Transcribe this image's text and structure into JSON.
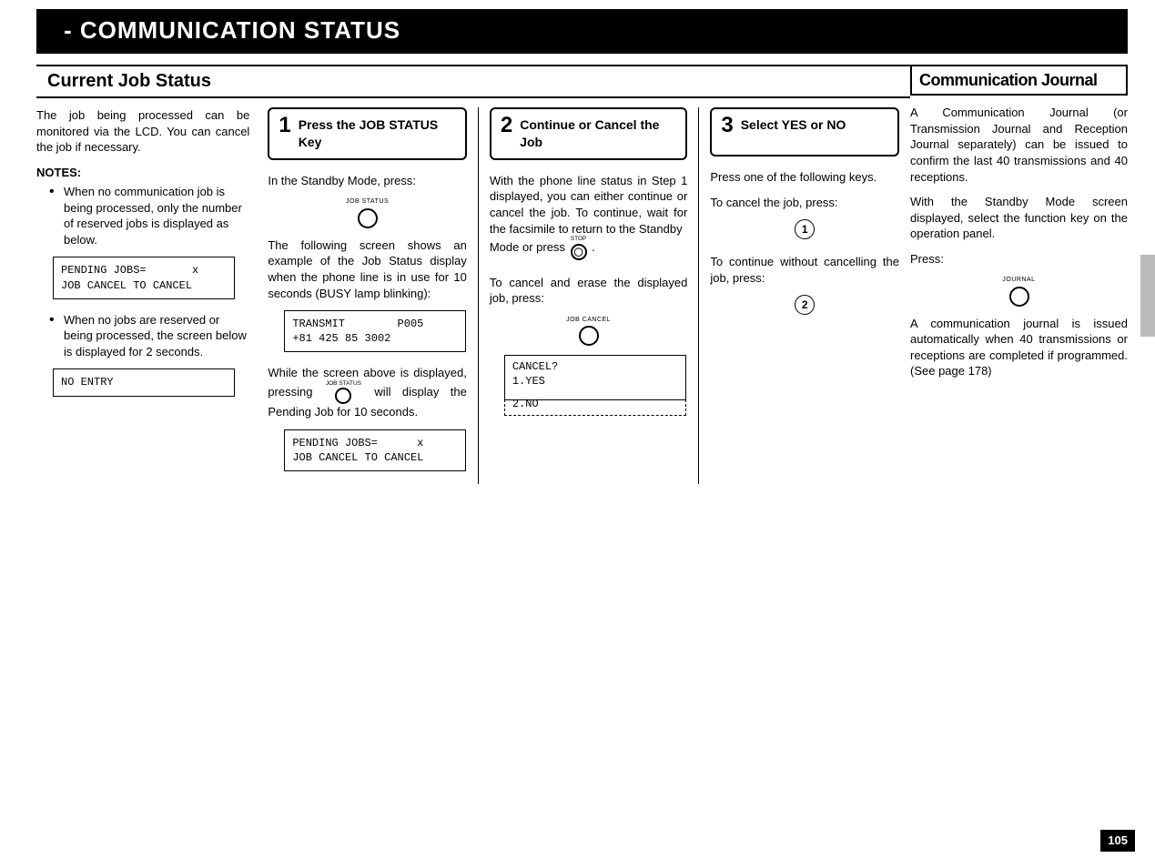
{
  "header": "- COMMUNICATION STATUS",
  "sectionLeft": "Current  Job  Status",
  "sectionRight": "Communication Journal",
  "pageNumber": "105",
  "intro": {
    "para1": "The job being processed can be monitored via the LCD. You can cancel the job if necessary.",
    "notesHead": "NOTES:",
    "bullet1": "When no communication job is being processed, only the number of reserved jobs is displayed as below.",
    "lcd1": "PENDING JOBS=       x\nJOB CANCEL TO CANCEL",
    "bullet2": "When no jobs are reserved or being processed, the screen below is displayed for 2 seconds.",
    "lcd2": "NO ENTRY"
  },
  "step1": {
    "num": "1",
    "title": "Press the JOB STATUS Key",
    "p1": "In the Standby Mode, press:",
    "keyLabel1": "JOB STATUS",
    "p2": "The following screen shows an example of the Job Status display when the phone line is in use for 10 seconds (BUSY lamp blinking):",
    "lcd1": "TRANSMIT        P005\n+81 425 85 3002",
    "p3a": "While the screen above is displayed, pressing ",
    "p3KeyLabel": "JOB STATUS",
    "p3b": " will display the Pending Job for 10 seconds.",
    "lcd2": "PENDING JOBS=      x\nJOB CANCEL TO CANCEL"
  },
  "step2": {
    "num": "2",
    "title": "Continue or Cancel the Job",
    "p1": "With the phone line status in Step 1 displayed, you can either continue or cancel the job. To continue, wait for the facsimile to return to the Standby",
    "p1b": "Mode or press ",
    "stopLabel": "STOP",
    "period": ".",
    "p2": "To cancel and erase the displayed job, press:",
    "keyLabel": "JOB CANCEL",
    "lcdTop": "CANCEL?\n1.YES",
    "lcdBottom": "2.NO"
  },
  "step3": {
    "num": "3",
    "title": "Select YES or NO",
    "p1": "Press one of the following keys.",
    "p2": "To cancel the job, press:",
    "key1": "1",
    "p3": "To continue without cancelling the job, press:",
    "key2": "2"
  },
  "journal": {
    "p1": "A Communication Journal (or Transmission Journal and Reception Journal separately) can be issued to confirm the last 40 transmissions and 40 receptions.",
    "p2": "With the Standby Mode screen displayed, select the function key on the operation panel.",
    "p3": "Press:",
    "keyLabel": "JOURNAL",
    "p4": "A communication journal is issued automatically when 40 transmissions or receptions are completed if programmed. (See page 178)"
  }
}
